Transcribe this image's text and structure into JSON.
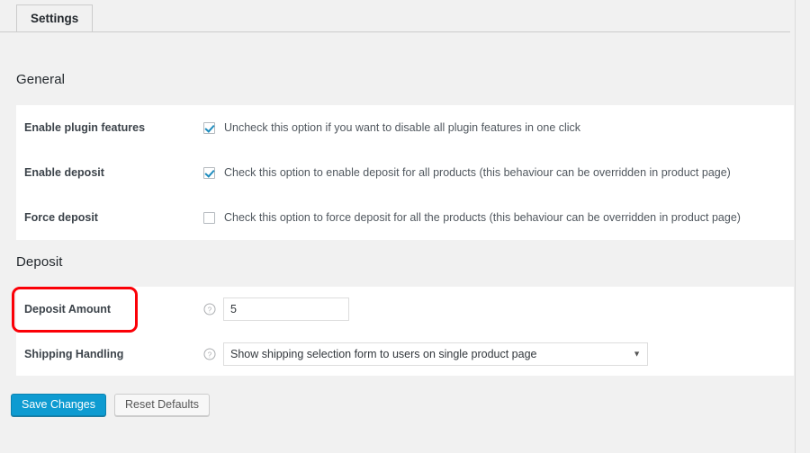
{
  "tabs": [
    {
      "label": "Settings",
      "active": true
    }
  ],
  "sections": [
    {
      "id": "general",
      "heading": "General",
      "rows": [
        {
          "label": "Enable plugin features",
          "control": "checkbox",
          "checked": true,
          "text": "Uncheck this option if you want to disable all plugin features in one click"
        },
        {
          "label": "Enable deposit",
          "control": "checkbox",
          "checked": true,
          "text": "Check this option to enable deposit for all products (this behaviour can be overridden in product page)"
        },
        {
          "label": "Force deposit",
          "control": "checkbox",
          "checked": false,
          "text": "Check this option to force deposit for all the products (this behaviour can be overridden in product page)"
        }
      ]
    },
    {
      "id": "deposit",
      "heading": "Deposit",
      "rows": [
        {
          "label": "Deposit Amount",
          "control": "text",
          "help_icon": "help-circle-icon",
          "value": "5",
          "placeholder": ""
        },
        {
          "label": "Shipping Handling",
          "control": "select",
          "help_icon": "help-circle-icon",
          "value": "Show shipping selection form to users on single product page",
          "arrow": "▼"
        }
      ]
    }
  ],
  "footer": {
    "save_label": "Save Changes",
    "reset_label": "Reset Defaults"
  },
  "annotation": {
    "target": "Deposit Amount",
    "color": "#fb0007"
  },
  "colors": {
    "page_background": "#f1f1f1",
    "panel_background": "#ffffff",
    "primary_button": "#0e9bd1",
    "checkbox_check": "#1e8cbe",
    "label_text": "#3c434a",
    "body_text": "#50575e",
    "annotation": "#fb0007"
  }
}
